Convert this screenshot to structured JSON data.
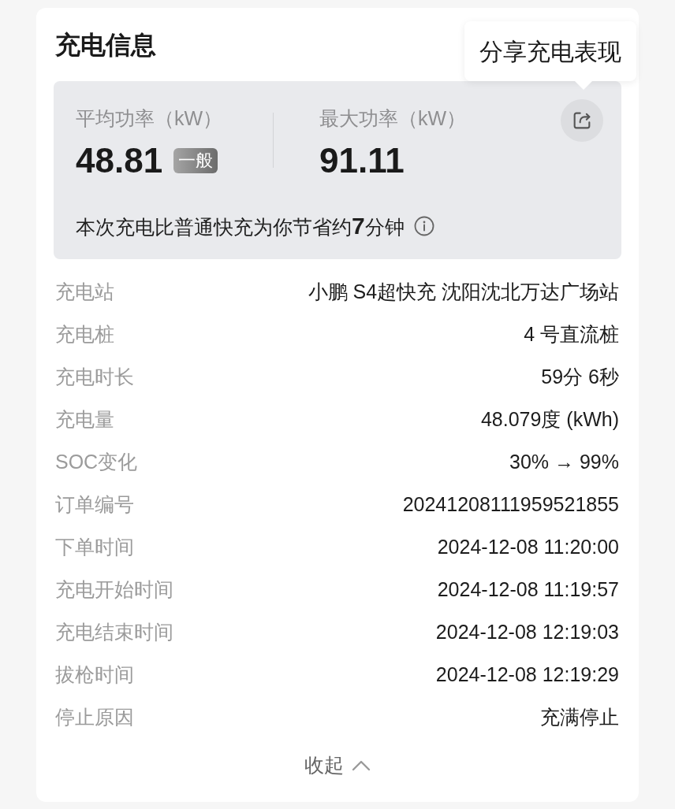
{
  "card": {
    "title": "充电信息"
  },
  "tooltip": {
    "text": "分享充电表现"
  },
  "summary": {
    "metrics": [
      {
        "label": "平均功率（kW）",
        "value": "48.81",
        "badge": "一般"
      },
      {
        "label": "最大功率（kW）",
        "value": "91.11"
      }
    ],
    "note": "本次充电比普通快充为你节省约**7**分钟"
  },
  "details": [
    {
      "label": "充电站",
      "value": "小鹏 S4超快充 沈阳沈北万达广场站"
    },
    {
      "label": "充电桩",
      "value": "4 号直流桩"
    },
    {
      "label": "充电时长",
      "value": "59分 6秒"
    },
    {
      "label": "充电量",
      "value": "48.079度 (kWh)"
    },
    {
      "label": "SOC变化",
      "value": "30% → 99%"
    },
    {
      "label": "订单编号",
      "value": "20241208111959521855"
    },
    {
      "label": "下单时间",
      "value": "2024-12-08 11:20:00"
    },
    {
      "label": "充电开始时间",
      "value": "2024-12-08 11:19:57"
    },
    {
      "label": "充电结束时间",
      "value": "2024-12-08 12:19:03"
    },
    {
      "label": "拔枪时间",
      "value": "2024-12-08 12:19:29"
    },
    {
      "label": "停止原因",
      "value": "充满停止"
    }
  ],
  "collapse": {
    "label": "收起",
    "expanded": true
  }
}
